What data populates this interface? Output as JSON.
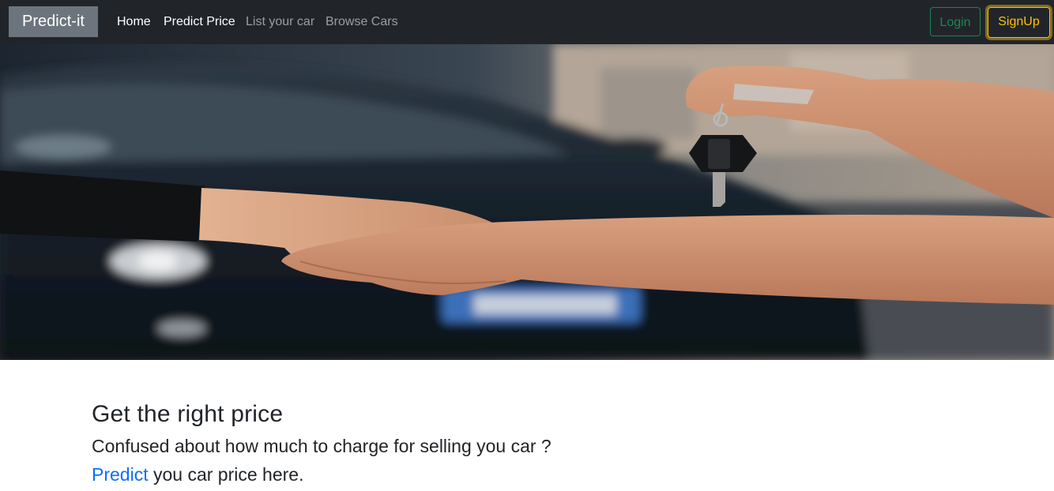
{
  "navbar": {
    "brand": "Predict-it",
    "links": [
      {
        "label": "Home"
      },
      {
        "label": "Predict Price"
      },
      {
        "label": "List your car"
      },
      {
        "label": "Browse Cars"
      }
    ],
    "login_label": "Login",
    "signup_label": "SignUp",
    "colors": {
      "background": "#212529",
      "login": "#198754",
      "signup": "#ffc107"
    }
  },
  "hero": {
    "image_description_icon": "car-key-handshake-image"
  },
  "main": {
    "heading": "Get the right price",
    "subheading": "Confused about how much to charge for selling you car ?",
    "cta_link": "Predict",
    "cta_rest": " you car price here.",
    "link_color": "#0d6efd"
  }
}
